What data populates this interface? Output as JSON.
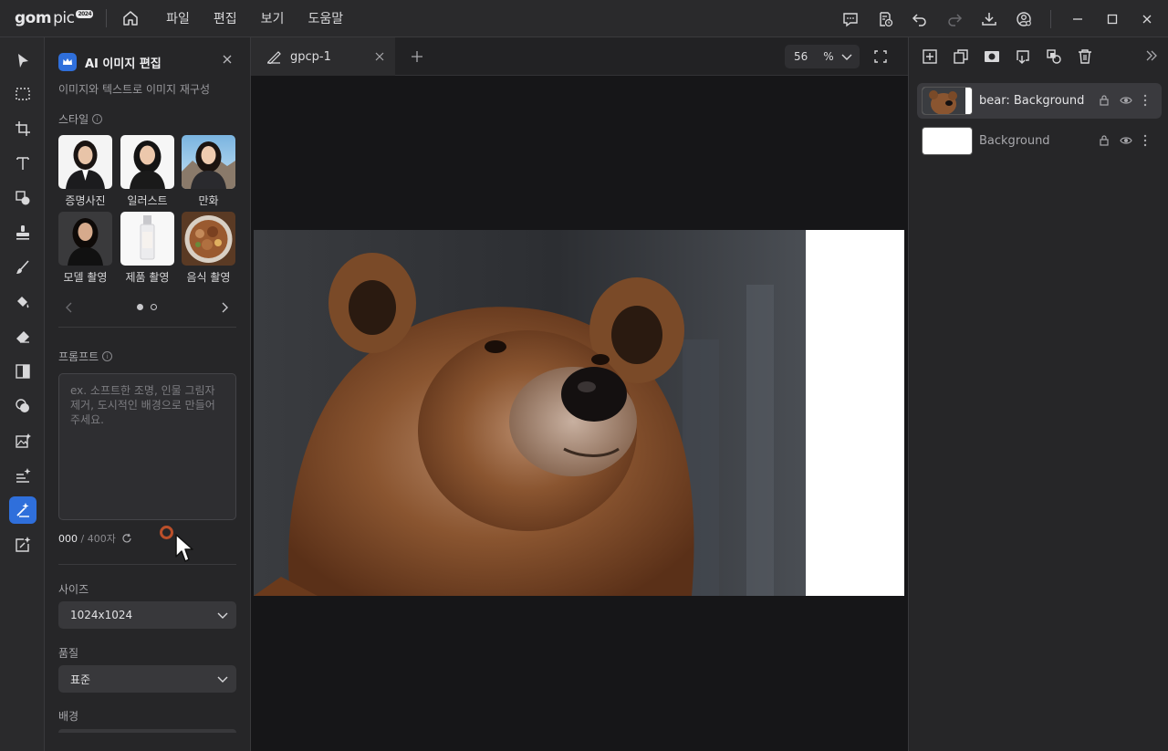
{
  "app": {
    "logo_text": "gom",
    "logo_pic": "pic",
    "logo_badge": "2024"
  },
  "menu": [
    "파일",
    "편집",
    "보기",
    "도움말"
  ],
  "panel": {
    "title": "AI 이미지 편집",
    "subtitle": "이미지와 텍스트로 이미지 재구성",
    "style_label": "스타일",
    "styles": [
      "증명사진",
      "일러스트",
      "만화",
      "모델 촬영",
      "제품 촬영",
      "음식 촬영"
    ],
    "prompt_label": "프롬프트",
    "prompt_placeholder": "ex. 소프트한 조명, 인물 그림자 제거, 도시적인 배경으로 만들어 주세요.",
    "counter_current": "000",
    "counter_max": " / 400자",
    "size_label": "사이즈",
    "size_value": "1024x1024",
    "quality_label": "품질",
    "quality_value": "표준",
    "background_label": "배경"
  },
  "document": {
    "tab_name": "gpcp-1",
    "zoom_value": "56",
    "zoom_unit": "%"
  },
  "layers": [
    {
      "name": "bear: Background",
      "selected": true
    },
    {
      "name": "Background",
      "selected": false
    }
  ],
  "colors": {
    "accent": "#2f6fdb",
    "background": "#1b1b1d",
    "panel": "#262628"
  }
}
